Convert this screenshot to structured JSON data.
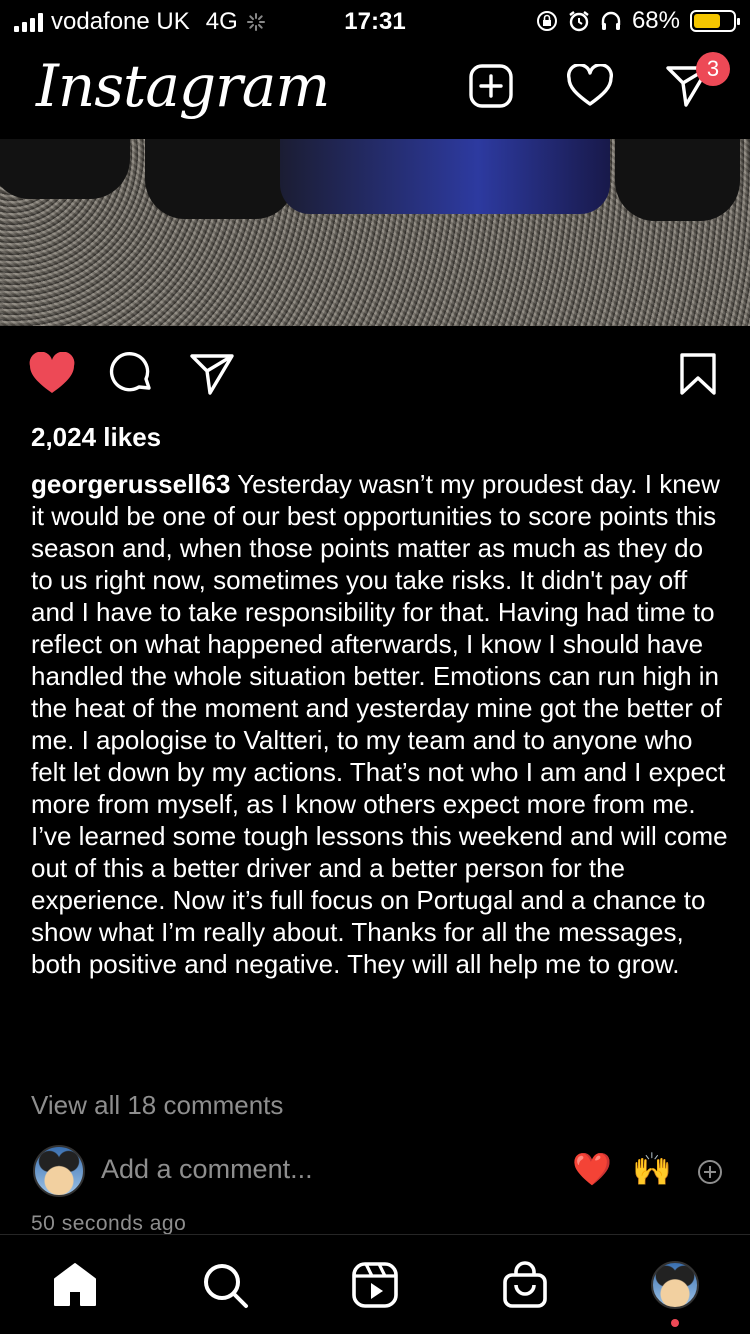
{
  "status_bar": {
    "carrier": "vodafone UK",
    "network": "4G",
    "time": "17:31",
    "battery_percent": "68%",
    "battery_level": 0.68,
    "battery_color": "#f5c600",
    "icons": [
      "signal-icon",
      "loading-icon",
      "orientation-lock-icon",
      "alarm-icon",
      "headphones-icon",
      "battery-icon"
    ]
  },
  "header": {
    "logo": "Instagram",
    "direct_badge_count": "3",
    "badge_color": "#ed4956",
    "icons": [
      "new-post-icon",
      "activity-heart-icon",
      "direct-message-icon"
    ]
  },
  "post": {
    "liked": true,
    "like_color": "#ed4956",
    "likes": "2,024 likes",
    "username": "georgerussell63",
    "caption": "Yesterday wasn’t my proudest day. I knew it would be one of our best opportunities to score points this season and, when those points matter as much as they do to us right now, sometimes you take risks. It didn't pay off and I have to take responsibility for that. Having had time to reflect on what happened afterwards, I know I should have handled the whole situation better. Emotions can run high in the heat of the moment and yesterday mine got the better of me. I apologise to Valtteri, to my team and to anyone who felt let down by my actions. That’s not who I am and I expect more from myself, as I know others expect more from me. I’ve learned some tough lessons this weekend and will come out of this a better driver and a better person for the experience. Now it’s full focus on Portugal and a chance to show what I’m really about. Thanks for all the messages, both positive and negative. They will all help me to grow.",
    "view_comments": "View all 18 comments",
    "comment_placeholder": "Add a comment...",
    "quick_reactions": [
      "❤️",
      "🙌"
    ],
    "timestamp": "50 seconds ago"
  },
  "tab_bar": {
    "tabs": [
      "home-icon",
      "search-icon",
      "reels-icon",
      "shop-icon",
      "profile-avatar"
    ]
  }
}
